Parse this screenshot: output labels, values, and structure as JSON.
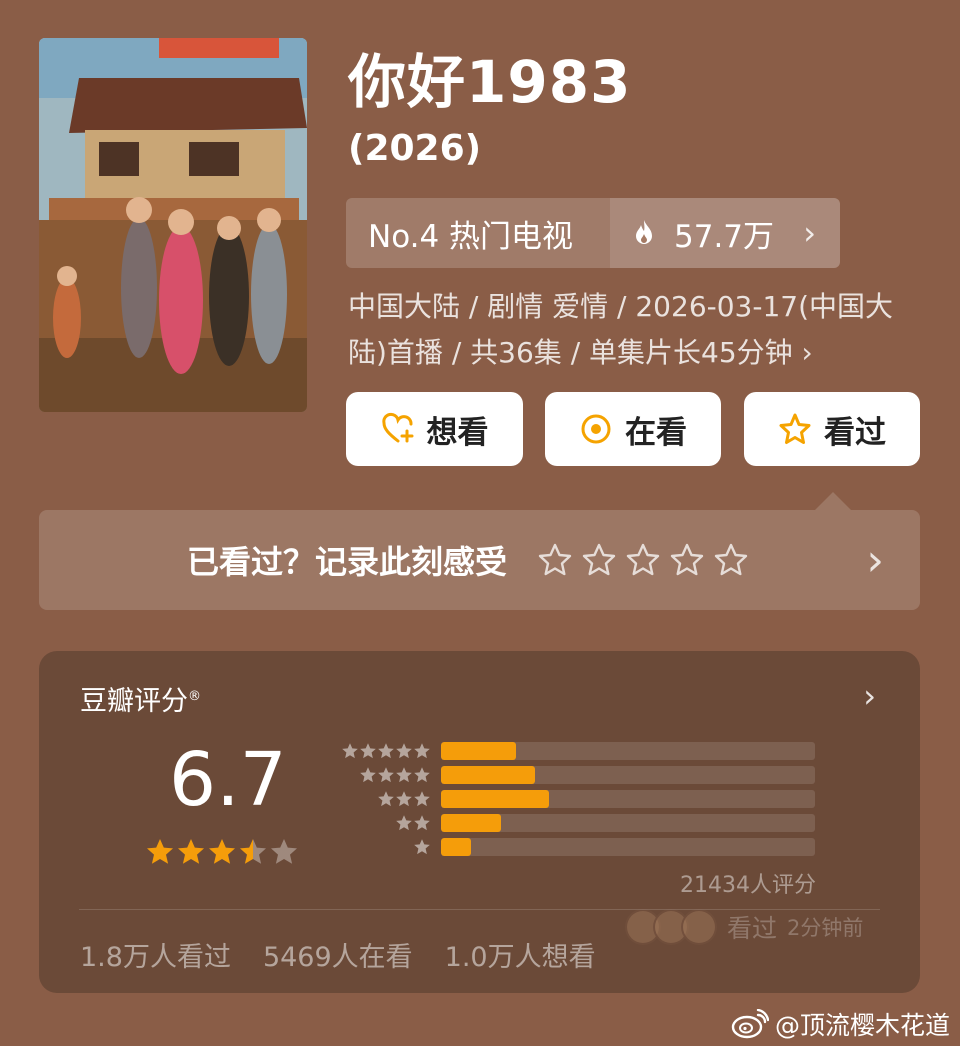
{
  "show": {
    "title": "你好1983",
    "year": "(2026)",
    "rank_label": "No.4 热门电视",
    "heat_value": "57.7万",
    "meta_line": "中国大陆 / 剧情 爱情 / 2026-03-17(中国大陆)首播 / 共36集 / 单集片长45分钟 ›"
  },
  "actions": {
    "want_label": "想看",
    "watching_label": "在看",
    "watched_label": "看过"
  },
  "record": {
    "prompt": "已看过？记录此刻感受",
    "stars": 5
  },
  "rating": {
    "title": "豆瓣评分",
    "registered_mark": "®",
    "score": "6.7",
    "star_level": 3.5,
    "raters_text": "21434人评分",
    "distribution": [
      {
        "stars": 5,
        "fraction": 0.2
      },
      {
        "stars": 4,
        "fraction": 0.25
      },
      {
        "stars": 3,
        "fraction": 0.29
      },
      {
        "stars": 2,
        "fraction": 0.16
      },
      {
        "stars": 1,
        "fraction": 0.08
      }
    ],
    "stats": {
      "watched": "1.8万人看过",
      "watching": "5469人在看",
      "want": "1.0万人想看"
    },
    "recent": {
      "action": "看过",
      "ago": "2分钟前"
    }
  },
  "watermark": "@顶流樱木花道",
  "colors": {
    "background": "#8a5d47",
    "card": "#6b4a38",
    "accent": "#f59d0a",
    "button_icon": "#f5a300"
  }
}
